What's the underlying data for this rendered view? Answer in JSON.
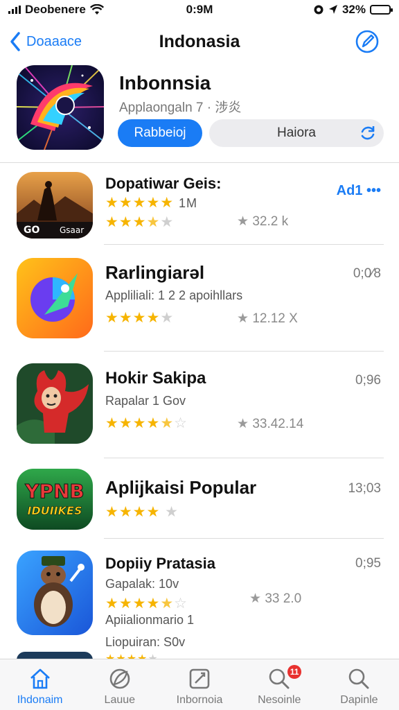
{
  "status_bar": {
    "carrier": "Deobenere",
    "time": "0:9M",
    "battery": "32%",
    "battery_level": 0.32,
    "icons": [
      "signal-icon",
      "wifi-icon",
      "alarm-icon",
      "location-icon",
      "battery-icon"
    ]
  },
  "nav": {
    "back_label": "Doaaace",
    "title": "Indonasia",
    "icons": [
      "chevron-left-icon",
      "compose-icon"
    ]
  },
  "featured": {
    "name": "Inbonnsia",
    "subtitle": "Applaongaln 7 · 涉炎",
    "primary_button": "Rabbeioj",
    "secondary_button": "Haiora",
    "icon": "refresh-icon"
  },
  "apps": [
    {
      "name": "Dopatiwar Geis:",
      "rating_text": "1M",
      "stars": 4,
      "stars2": 3.5,
      "count": "32.2 k",
      "right": "Ad1 •••",
      "right_is_action": true
    },
    {
      "name": "Rarlingiarəl",
      "subtitle": "Appliliali: 1 2 2 apoihllars",
      "stars": 4,
      "count": "12.12 X",
      "right": "0;0⁄8"
    },
    {
      "name": "Hokir Sakipa",
      "subtitle": "Rapalar 1 Gov",
      "stars": 4.5,
      "count": "33.42.14",
      "right": "0;96"
    },
    {
      "name": "Aplijkaisi Popular",
      "stars": 4,
      "right": "13;03"
    },
    {
      "name": "Dopiiy Pratasia",
      "subtitle": "Gapalak: 10v",
      "subtitle2": "Apiialionmario 1",
      "subtitle3": "Liopuiran: S0v",
      "stars": 4.5,
      "count": "33 2.0",
      "right": "0;95"
    }
  ],
  "tabs": [
    {
      "label": "Ihdonaim",
      "icon": "house-icon",
      "active": true
    },
    {
      "label": "Lauue",
      "icon": "rocket-icon"
    },
    {
      "label": "Inbornoia",
      "icon": "square-pen-icon"
    },
    {
      "label": "Nesoinle",
      "icon": "search-badge-icon",
      "badge": "11"
    },
    {
      "label": "Dapinle",
      "icon": "search-icon"
    }
  ],
  "colors": {
    "accent": "#1a7cf5",
    "star": "#f6b400",
    "badge": "#e8312f"
  }
}
